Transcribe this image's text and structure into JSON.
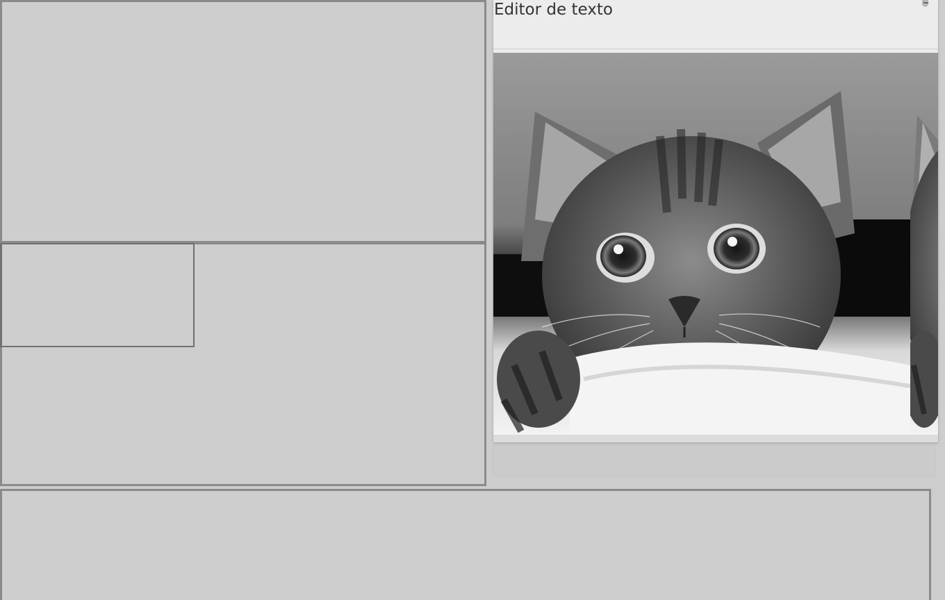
{
  "editor": {
    "title": "Editor de texto",
    "image_semantic": "kitten-photo",
    "colors": {
      "window_bg": "#ececec",
      "title_text": "#333333",
      "desktop_bg": "#cdcdcd",
      "pane_border": "#8a8a8a"
    }
  },
  "icons": {
    "window_control": "minimize-icon"
  }
}
